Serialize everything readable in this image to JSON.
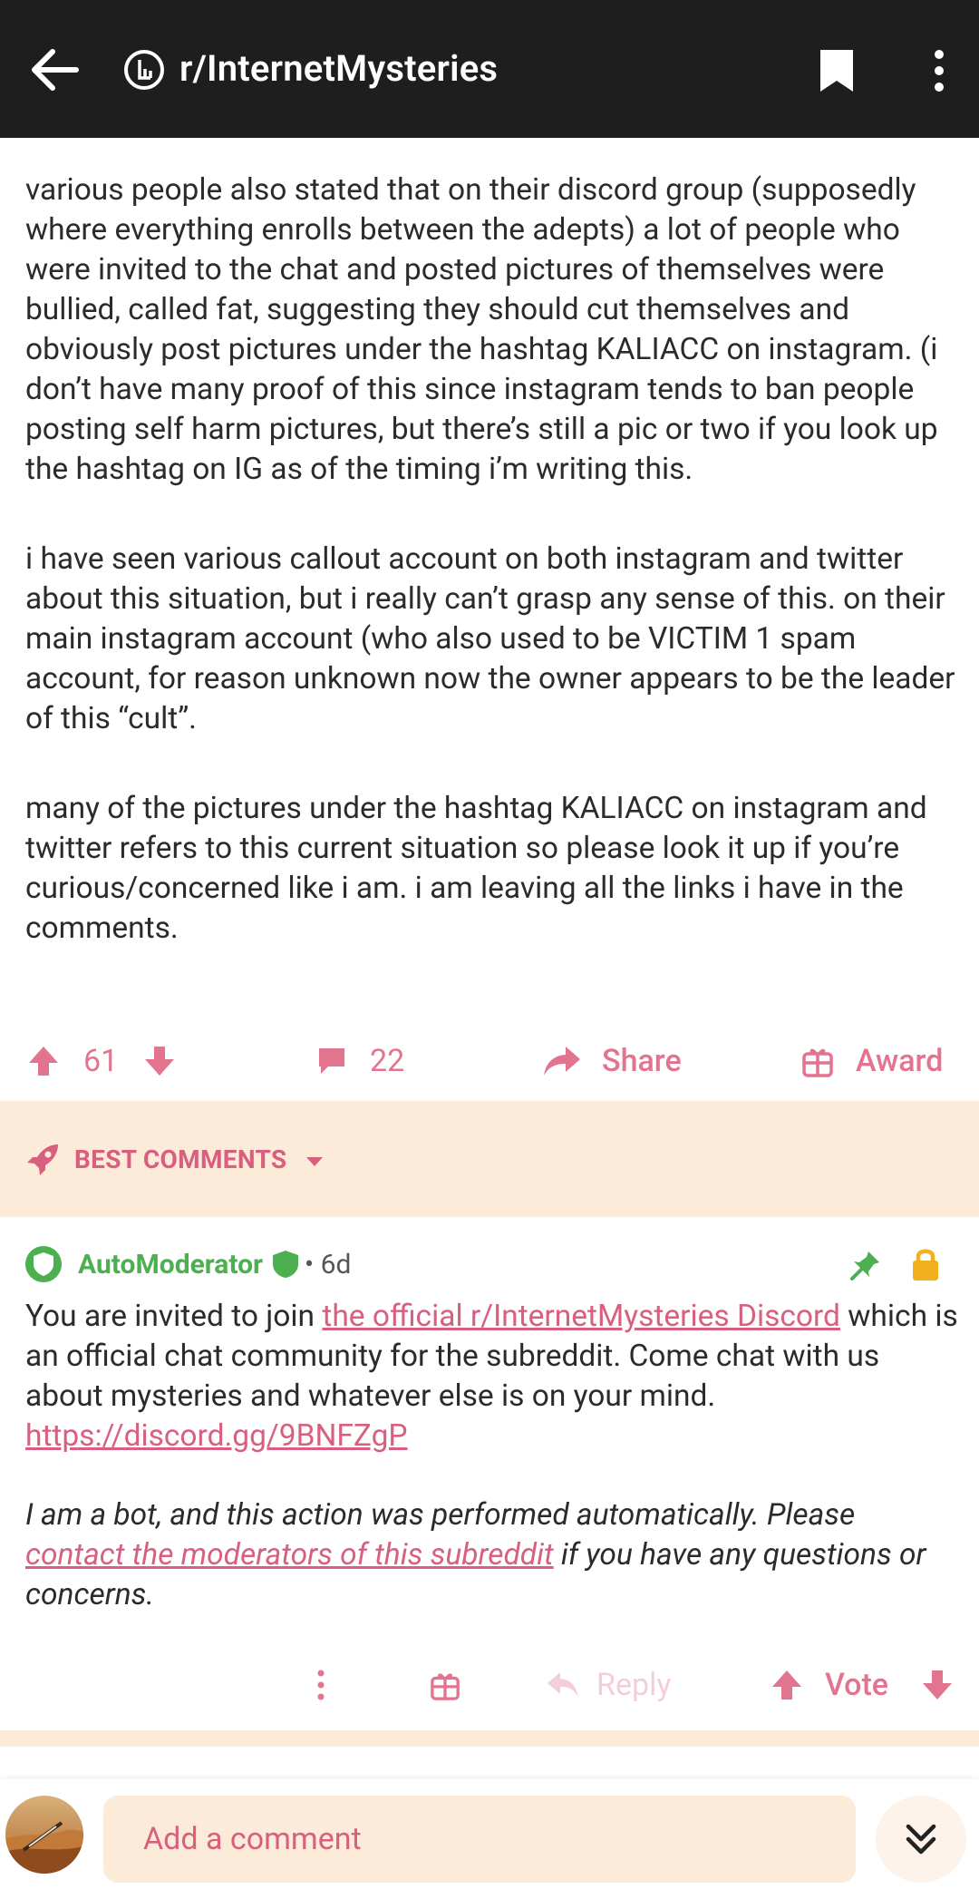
{
  "header": {
    "subreddit": "r/InternetMysteries",
    "icons": [
      "back-arrow-icon",
      "subreddit-logo-icon",
      "bookmark-icon",
      "more-vert-icon"
    ]
  },
  "post": {
    "paragraphs": [
      "various people also stated that on their discord group (supposedly where everything enrolls between the adepts) a lot of people who were invited to the chat and posted pictures of themselves were bullied, called fat, suggesting they should cut themselves and obviously post pictures under the hashtag KALIACC on instagram. (i don’t have many proof of this since instagram tends to ban people posting self harm pictures, but there’s still a pic or two if you look up the hashtag on IG as of the timing i’m writing this.",
      "i have seen various callout account on both instagram and twitter about this situation, but i really can’t grasp any sense of this. on their main instagram account (who also used to be VICTIM 1 spam account, for reason unknown now the owner appears to be the leader of this “cult”.",
      "many of the pictures under the hashtag KALIACC on instagram and twitter refers to this current situation so please look it up if you’re curious/concerned like i am. i am leaving all the links i have in the comments."
    ],
    "score": "61",
    "comments_count": "22",
    "share_label": "Share",
    "award_label": "Award"
  },
  "sort": {
    "label": "BEST COMMENTS"
  },
  "comment": {
    "author": "AutoModerator",
    "age": "• 6d",
    "line1_before": "You are invited to join ",
    "line1_link": "the official r/InternetMysteries Discord",
    "line1_after": " which is an official chat community for the subreddit.  Come chat with us about mysteries and whatever else is on your mind.  ",
    "discord_url": "https://discord.gg/9BNFZgP",
    "bot_before": "I am a bot, and this action was performed automatically. Please ",
    "bot_link": "contact the moderators of this subreddit",
    "bot_after": " if you have any questions or concerns.",
    "reply_label": "Reply",
    "vote_label": "Vote"
  },
  "composer": {
    "placeholder": "Add a comment"
  },
  "colors": {
    "accent": "#e2748f",
    "band": "#fdebd9",
    "mod_green": "#4caf50",
    "lock_amber": "#f2b01e"
  }
}
